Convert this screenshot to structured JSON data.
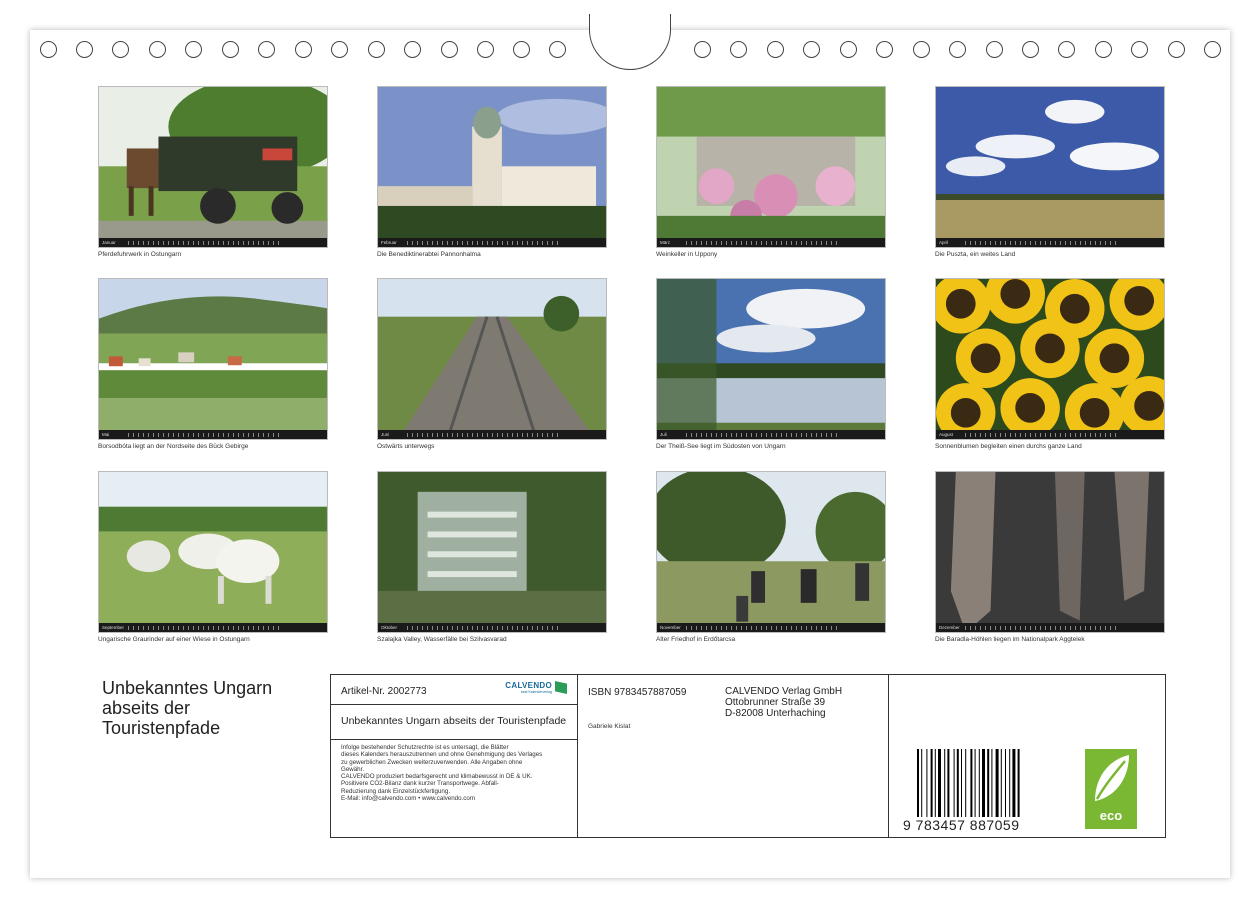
{
  "calendar": {
    "title": "Unbekanntes Ungarn abseits der Touristenpfade",
    "photos": [
      {
        "month": "Januar",
        "caption": "Pferdefuhrwerk in Ostungarn",
        "scene": "cart"
      },
      {
        "month": "Februar",
        "caption": "Die Benediktinerabtei Pannonhalma",
        "scene": "abbey"
      },
      {
        "month": "März",
        "caption": "Weinkeller in Uppony",
        "scene": "cellar"
      },
      {
        "month": "April",
        "caption": "Die Puszta, ein weites Land",
        "scene": "puszta"
      },
      {
        "month": "Mai",
        "caption": "Borsodbóta liegt an der Nordseite des Bück Gebirge",
        "scene": "village"
      },
      {
        "month": "Juni",
        "caption": "Ostwärts unterwegs",
        "scene": "rails"
      },
      {
        "month": "Juli",
        "caption": "Der Theiß-See liegt im Südosten von Ungarn",
        "scene": "lake"
      },
      {
        "month": "August",
        "caption": "Sonnenblumen begleiten einen durchs ganze Land",
        "scene": "sunflowers"
      },
      {
        "month": "September",
        "caption": "Ungarische Graurinder auf einer Wiese in Ostungarn",
        "scene": "cattle"
      },
      {
        "month": "Oktober",
        "caption": "Szalajka Valley, Wasserfälle bei Szilvasvarad",
        "scene": "waterfall"
      },
      {
        "month": "November",
        "caption": "Alter Friedhof in Erdőtarcsa",
        "scene": "cemetery"
      },
      {
        "month": "Dezember",
        "caption": "Die Baradla-Höhlen liegen im Nationalpark Aggtelek",
        "scene": "cave"
      }
    ]
  },
  "info": {
    "article": "Artikel-Nr. 2002773",
    "brand": "CALVENDO",
    "brand_sub": "best Kalenderverlag",
    "subtitle": "Unbekanntes Ungarn abseits der Touristenpfade",
    "legal": [
      "Infolge bestehender Schutzrechte ist es untersagt, die Blätter",
      "dieses Kalenders herauszutrennen und ohne Genehmigung des Verlages",
      "zu gewerblichen Zwecken weiterzuverwenden. Alle Angaben ohne",
      "Gewähr.",
      "CALVENDO produziert bedarfsgerecht und klimabewusst in DE & UK.",
      "Positivere CO2-Bilanz dank kurzer Transportwege. Abfall-",
      "Reduzierung dank Einzelstückfertigung.",
      "E-Mail: info@calvendo.com • www.calvendo.com"
    ],
    "isbn": "ISBN 9783457887059",
    "author": "Gabriele Kislat",
    "publisher": [
      "CALVENDO Verlag GmbH",
      "Ottobrunner Straße 39",
      "D-82008 Unterhaching"
    ],
    "barcode_digits": "9  783457  887059",
    "eco_label": "eco"
  },
  "colors": {
    "eco_green": "#7ab833",
    "brand_blue": "#1a6a9c"
  }
}
